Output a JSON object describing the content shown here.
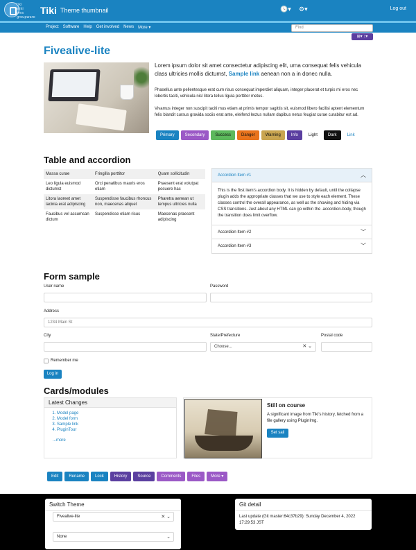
{
  "header": {
    "logo_text": "tiki\nwiki\ncms\ngroupware",
    "brand": "Tiki",
    "site_title": "Theme thumbnail",
    "clock_icon": "clock-icon",
    "tools_icon": "cogs-icon",
    "logout": "Log out"
  },
  "nav": {
    "items": [
      "Project",
      "Software",
      "Help",
      "Get involved",
      "News",
      "More ▾"
    ],
    "search_placeholder": "Find",
    "lang_label": "⊞▾ ↕▾"
  },
  "main": {
    "title": "Fivealive-lite",
    "lead_1": "Lorem ipsum dolor sit amet consectetur adipiscing elit, urna consequat felis vehicula class ultricies mollis dictumst,",
    "lead_link": "Sample link",
    "lead_2": "aenean non a in donec nulla.",
    "para_1": "Phasellus ante pellentesque erat cum risus consequat imperdiet aliquam, integer placerat et turpis mi eros nec lobortis taciti, vehicula nisl litora tellus ligula porttitor metus.",
    "para_2": "Vivamus integer non suscipit taciti mus etiam at primis tempor sagittis sit, euismod libero facilisi aptent elementum felis blandit cursus gravida sociis erat ante, eleifend lectus nullam dapibus netus feugiat curae curabitur est ad.",
    "buttons": [
      {
        "label": "Primary",
        "color": "#1a83c1",
        "text": "#ffffff"
      },
      {
        "label": "Secondary",
        "color": "#9b59c6",
        "text": "#ffffff"
      },
      {
        "label": "Success",
        "color": "#5cb85c",
        "text": "#111111"
      },
      {
        "label": "Danger",
        "color": "#e8731c",
        "text": "#111111"
      },
      {
        "label": "Warning",
        "color": "#c9a550",
        "text": "#111111"
      },
      {
        "label": "Info",
        "color": "#5b3fa0",
        "text": "#ffffff"
      },
      {
        "label": "Light",
        "color": "#ffffff",
        "text": "#111111"
      },
      {
        "label": "Dark",
        "color": "#111111",
        "text": "#ffffff"
      },
      {
        "label": "Link",
        "color": "#ffffff",
        "text": "#1a83c1"
      }
    ]
  },
  "table_section": {
    "title": "Table and accordion",
    "rows": [
      [
        "Massa curae",
        "Fringilla porttitor",
        "Quam sollicitudin"
      ],
      [
        "Leo ligula euismod dictumst",
        "Orci penatibus mauris eros etiam",
        "Praesent erat volutpat posuere hac"
      ],
      [
        "Litora laoreet amet lacinia erat adipiscing",
        "Suspendisse faucibus rhoncus non, maecenas aliquet",
        "Pharetra aenean ut tempus ultricies nulla"
      ],
      [
        "Faucibus vel accumsan dictum",
        "Suspendisse etiam risus",
        "Maecenas praesent adipiscing"
      ]
    ],
    "accordion": {
      "item_1": "Accordion Item #1",
      "body": "This is the first item's accordion body. It is hidden by default, until the collapse plugin adds the appropriate classes that we use to style each element. These classes control the overall appearance, as well as the showing and hiding via CSS transitions. Just about any HTML can go within the .accordion-body, though the transition does limit overflow.",
      "item_2": "Accordion Item #2",
      "item_3": "Accordion Item #3"
    }
  },
  "form": {
    "title": "Form sample",
    "username_label": "User name",
    "password_label": "Password",
    "address_label": "Address",
    "address_placeholder": "1234 Main St",
    "city_label": "City",
    "state_label": "State/Prefecture",
    "state_value": "Choose...",
    "postal_label": "Postal code",
    "remember": "Remember me",
    "login": "Log in"
  },
  "cards": {
    "title": "Cards/modules",
    "latest_title": "Latest Changes",
    "latest_items": [
      "Model page",
      "Model form",
      "Sample link",
      "PluginTour"
    ],
    "more": "...more",
    "card_title": "Still on course",
    "card_text": "A significant image from Tiki's history, fetched from a file gallery using PluginImg.",
    "card_button": "Set sail"
  },
  "actions": [
    {
      "label": "Edit",
      "color": "#1a83c1"
    },
    {
      "label": "Rename",
      "color": "#1a83c1"
    },
    {
      "label": "Lock",
      "color": "#1a83c1"
    },
    {
      "label": "History",
      "color": "#5b3fa0"
    },
    {
      "label": "Source",
      "color": "#5b3fa0"
    },
    {
      "label": "Comments",
      "color": "#9b59c6"
    },
    {
      "label": "Files",
      "color": "#9b59c6"
    },
    {
      "label": "More ▾",
      "color": "#9b59c6"
    }
  ],
  "footer": {
    "switch_title": "Switch Theme",
    "theme_value": "Fivealive-lite",
    "option_value": "None",
    "git_title": "Git detail",
    "git_text": "Last update (Git master:64c37b29): Sunday December 4, 2022 17:29:53 JST"
  }
}
